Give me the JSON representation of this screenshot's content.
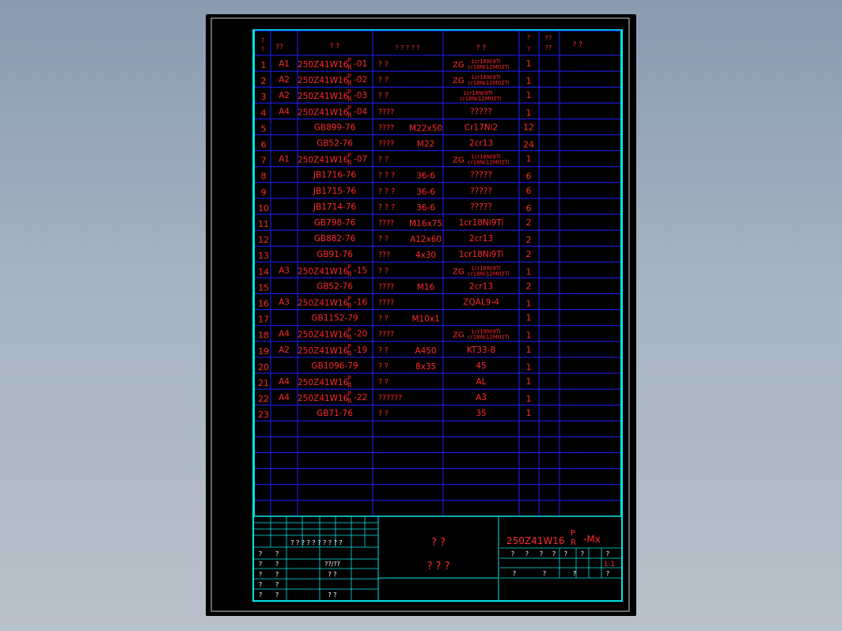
{
  "headers": {
    "seq": "?\n?",
    "size": "??",
    "code": "?  ?",
    "name": "? ? ? ? ?",
    "material": "?    ?",
    "qty": "?\n?",
    "weight1": "??\n??",
    "remark": "?   ?"
  },
  "rows": [
    {
      "seq": "1",
      "size": "A1",
      "code": "250Z41W16P/R-01",
      "name": "?     ?",
      "spec": "",
      "material": "ZG",
      "mat_super": "1cr18Ni9Ti",
      "mat_sub": "cr18Ni12M02Ti",
      "qty": "1"
    },
    {
      "seq": "2",
      "size": "A2",
      "code": "250Z41W16P/R-02",
      "name": "?     ?",
      "spec": "",
      "material": "ZG",
      "mat_super": "1cr18Ni9Ti",
      "mat_sub": "cr18Ni12M02Ti",
      "qty": "1"
    },
    {
      "seq": "3",
      "size": "A2",
      "code": "250Z41W16P/R-03",
      "name": "?     ?",
      "spec": "",
      "material": "",
      "mat_super": "1cr18Ni9Ti",
      "mat_sub": "cr18Ni12M02Ti",
      "qty": "1"
    },
    {
      "seq": "4",
      "size": "A4",
      "code": "250Z41W16P/R-04",
      "name": "????",
      "spec": "",
      "material": "?????",
      "mat_super": "",
      "mat_sub": "",
      "qty": "1"
    },
    {
      "seq": "5",
      "size": "",
      "code": "GB899-76",
      "name": "????",
      "spec": "M22x50",
      "material": "Cr17Ni2",
      "mat_super": "",
      "mat_sub": "",
      "qty": "12"
    },
    {
      "seq": "6",
      "size": "",
      "code": "GB52-76",
      "name": "????",
      "spec": "M22",
      "material": "2cr13",
      "mat_super": "",
      "mat_sub": "",
      "qty": "24"
    },
    {
      "seq": "7",
      "size": "A1",
      "code": "250Z41W16P/R-07",
      "name": "?   ?",
      "spec": "",
      "material": "ZG",
      "mat_super": "1cr18Ni9Ti",
      "mat_sub": "cr18Ni12M02Ti",
      "qty": "1"
    },
    {
      "seq": "8",
      "size": "",
      "code": "JB1716-76",
      "name": "?  ?  ?",
      "spec": "36-6",
      "material": "?????",
      "mat_super": "",
      "mat_sub": "",
      "qty": "6"
    },
    {
      "seq": "9",
      "size": "",
      "code": "JB1715-76",
      "name": "?  ?  ?",
      "spec": "36-6",
      "material": "?????",
      "mat_super": "",
      "mat_sub": "",
      "qty": "6"
    },
    {
      "seq": "10",
      "size": "",
      "code": "JB1714-76",
      "name": "?  ?  ?",
      "spec": "36-6",
      "material": "?????",
      "mat_super": "",
      "mat_sub": "",
      "qty": "6"
    },
    {
      "seq": "11",
      "size": "",
      "code": "GB798-76",
      "name": "????",
      "spec": "M16x75",
      "material": "1cr18Ni9Ti",
      "mat_super": "",
      "mat_sub": "",
      "qty": "2"
    },
    {
      "seq": "12",
      "size": "",
      "code": "GB882-76",
      "name": "?   ?",
      "spec": "A12x60",
      "material": "2cr13",
      "mat_super": "",
      "mat_sub": "",
      "qty": "2"
    },
    {
      "seq": "13",
      "size": "",
      "code": "GB91-76",
      "name": "???",
      "spec": "4x30",
      "material": "1cr18Ni9Ti",
      "mat_super": "",
      "mat_sub": "",
      "qty": "2"
    },
    {
      "seq": "14",
      "size": "A3",
      "code": "250Z41W16P/R-15",
      "name": "?   ?",
      "spec": "",
      "material": "ZG",
      "mat_super": "1cr18Ni9Ti",
      "mat_sub": "cr18Ni12M02Ti",
      "qty": "1"
    },
    {
      "seq": "15",
      "size": "",
      "code": "GB52-76",
      "name": "????",
      "spec": "M16",
      "material": "2cr13",
      "mat_super": "",
      "mat_sub": "",
      "qty": "2"
    },
    {
      "seq": "16",
      "size": "A3",
      "code": "250Z41W16P/R-16",
      "name": "????",
      "spec": "",
      "material": "ZQAL9-4",
      "mat_super": "",
      "mat_sub": "",
      "qty": "1"
    },
    {
      "seq": "17",
      "size": "",
      "code": "GB1152-79",
      "name": "?   ?",
      "spec": "M10x1",
      "material": "",
      "mat_super": "",
      "mat_sub": "",
      "qty": "1"
    },
    {
      "seq": "18",
      "size": "A4",
      "code": "250Z41W16P/R-20",
      "name": "????",
      "spec": "",
      "material": "ZG",
      "mat_super": "1cr18Ni9Ti",
      "mat_sub": "cr18Ni12M02Ti",
      "qty": "1"
    },
    {
      "seq": "19",
      "size": "A2",
      "code": "250Z41W16P/R-19",
      "name": "?   ?",
      "spec": "A450",
      "material": "KT33-8",
      "mat_super": "",
      "mat_sub": "",
      "qty": "1"
    },
    {
      "seq": "20",
      "size": "",
      "code": "GB1096-79",
      "name": "?   ?",
      "spec": "8x35",
      "material": "45",
      "mat_super": "",
      "mat_sub": "",
      "qty": "1"
    },
    {
      "seq": "21",
      "size": "A4",
      "code": "250Z41W16P/R",
      "name": "?   ?",
      "spec": "",
      "material": "AL",
      "mat_super": "",
      "mat_sub": "",
      "qty": "1"
    },
    {
      "seq": "22",
      "size": "A4",
      "code": "250Z41W16P/R-22",
      "name": "??????",
      "spec": "",
      "material": "A3",
      "mat_super": "",
      "mat_sub": "",
      "qty": "1"
    },
    {
      "seq": "23",
      "size": "",
      "code": "GB71-76",
      "name": "?   ?",
      "spec": "",
      "material": "35",
      "mat_super": "",
      "mat_sub": "",
      "qty": "1"
    }
  ],
  "title_block": {
    "drawing_no_base": "250Z41W16",
    "drawing_no_p": "P",
    "drawing_no_r": "R",
    "drawing_no_suffix": "-Mx",
    "name_line1": "?      ?",
    "name_line2": "?   ?   ?",
    "revision_header": "? ? ? ?   ?   ?   ?   ?   ?  ?",
    "left_rows": [
      {
        "a": "?",
        "b": "?",
        "c": "",
        "d": ""
      },
      {
        "a": "?",
        "b": "?",
        "c": "??/??",
        "d": ""
      },
      {
        "a": "?",
        "b": "?",
        "c": "?   ?",
        "d": ""
      },
      {
        "a": "?",
        "b": "?",
        "c": "",
        "d": ""
      },
      {
        "a": "?",
        "b": "?",
        "c": "?   ?",
        "d": ""
      }
    ],
    "right_header": [
      "?",
      "?",
      "?",
      "?",
      "?",
      "?",
      "?"
    ],
    "scale": "1:1",
    "bottom_labels": [
      "?",
      "?",
      "?",
      "?"
    ]
  },
  "colors": {
    "frame": "#00e5e5",
    "grid": "#2020ff",
    "text": "#ff2a2a",
    "sheet": "#000000"
  }
}
